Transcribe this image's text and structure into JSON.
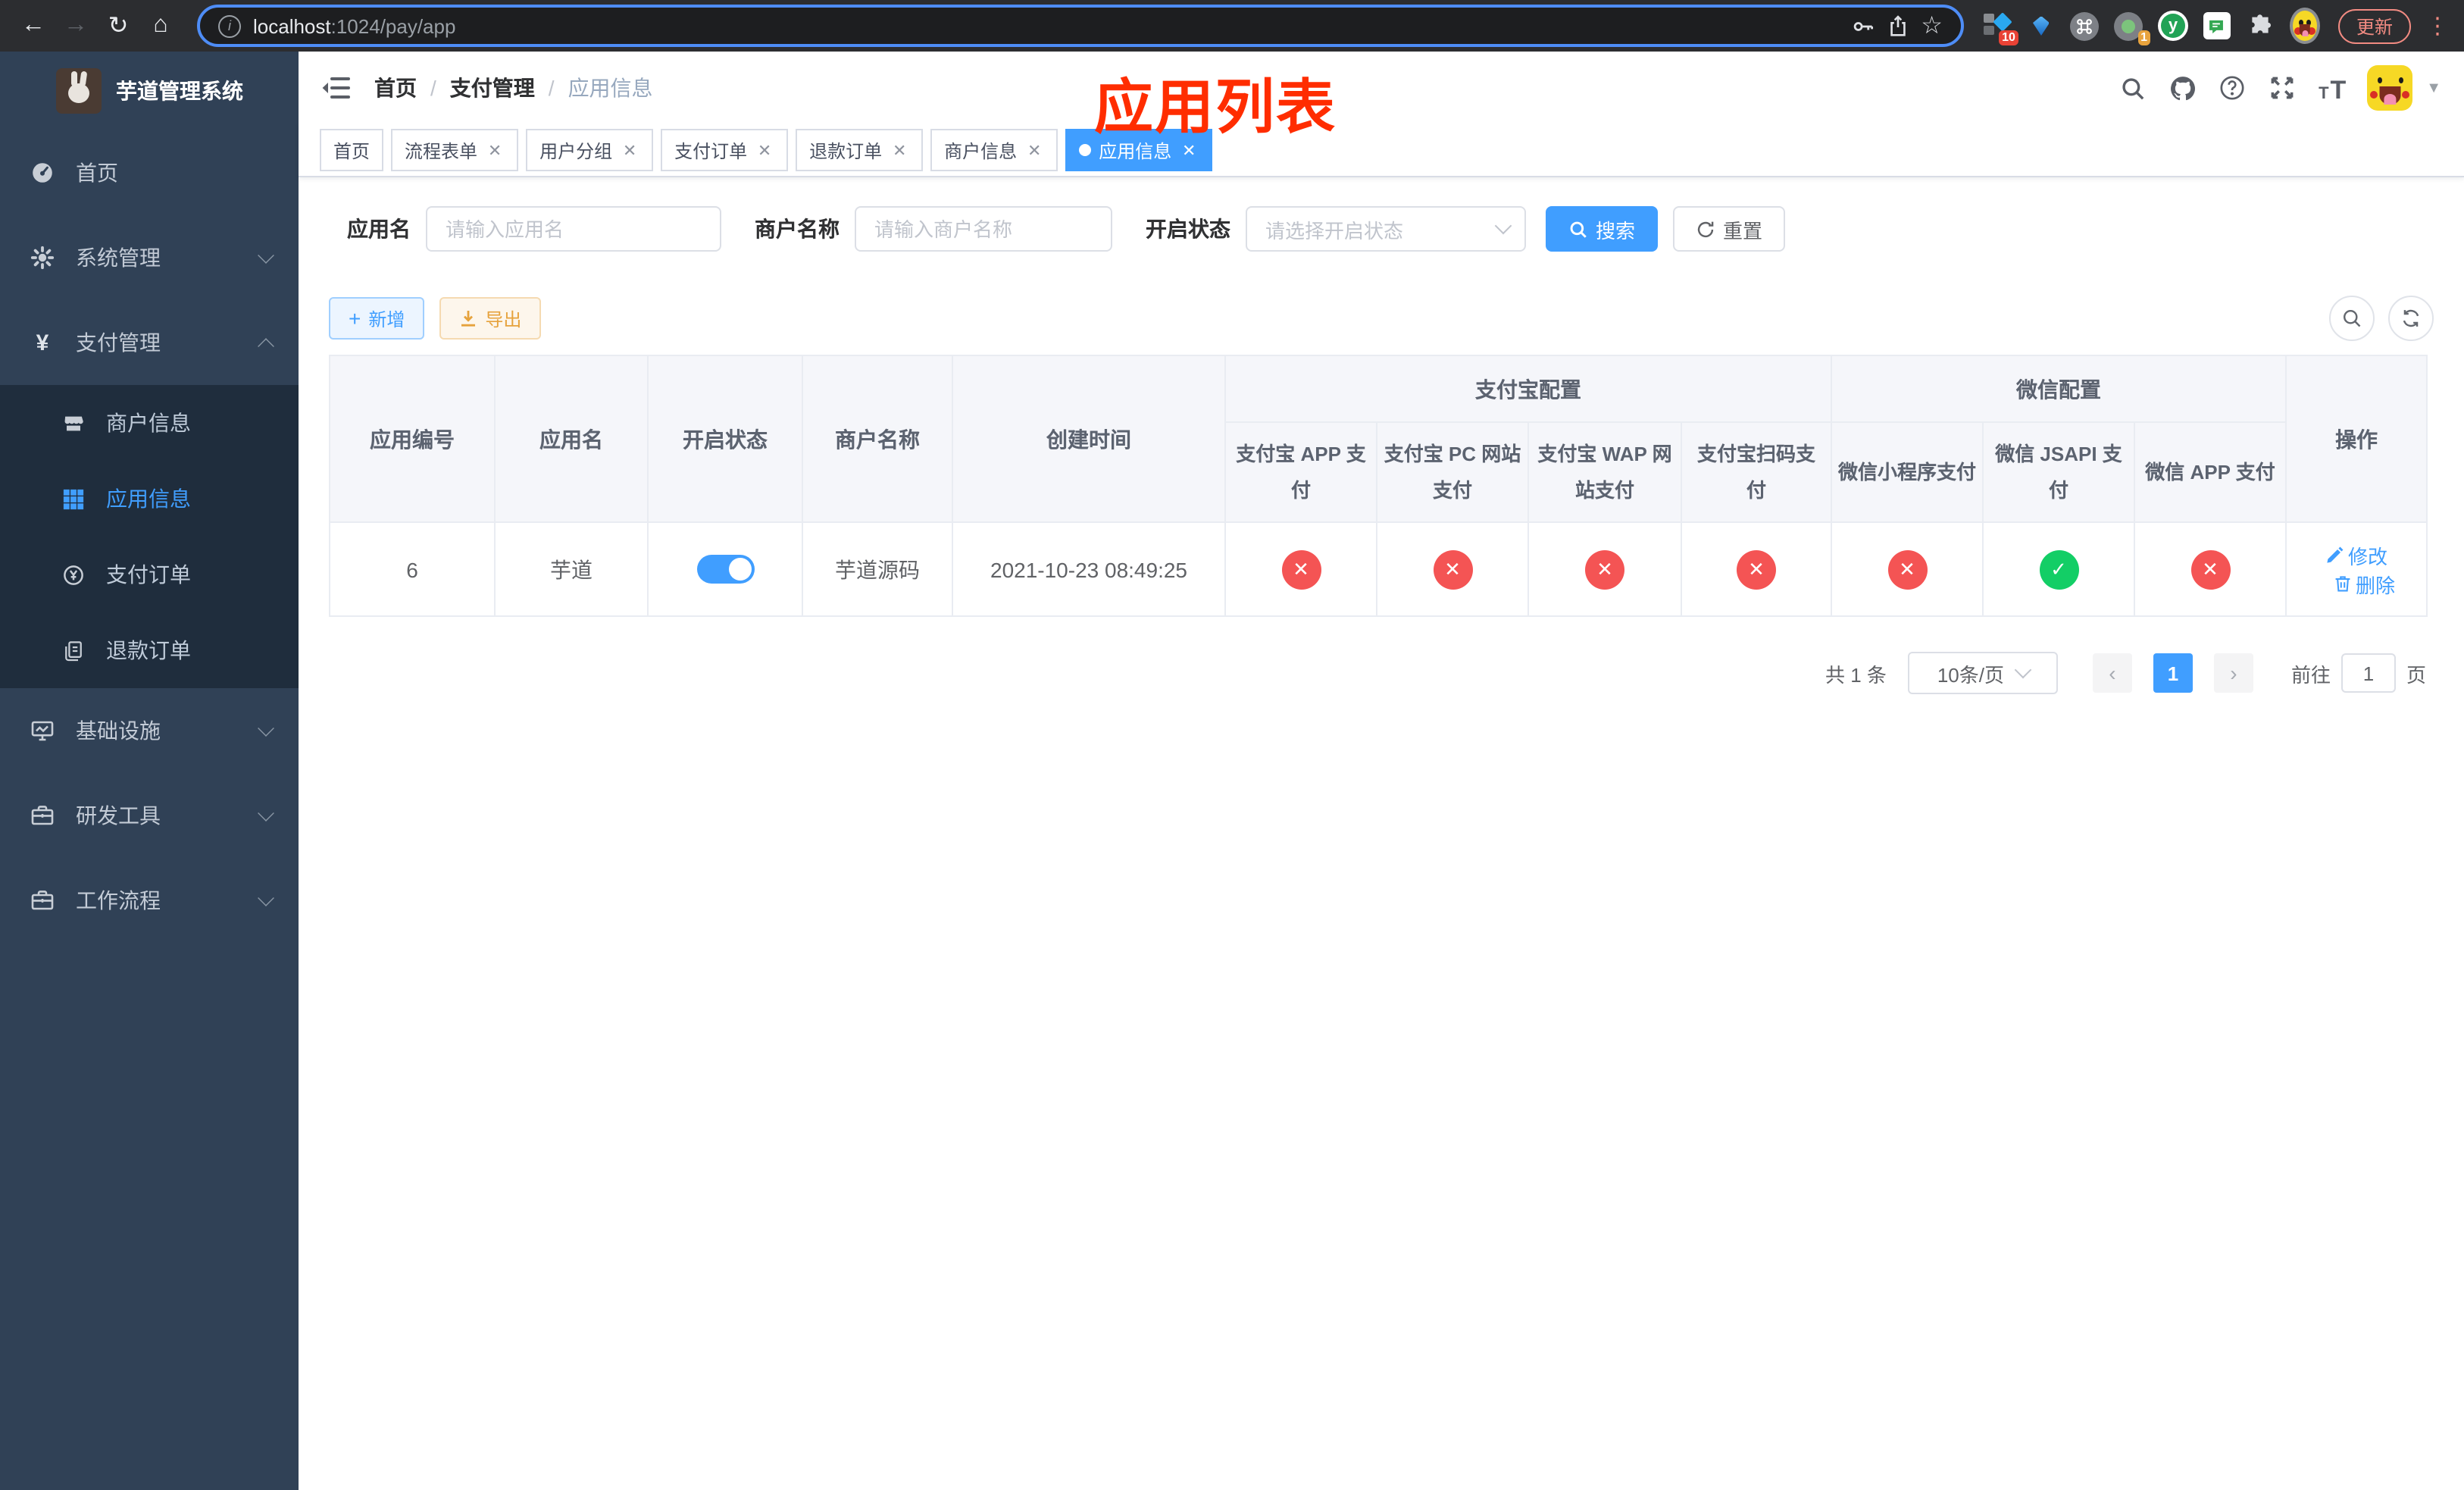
{
  "colors": {
    "primary": "#409eff",
    "success": "#13ce66",
    "danger": "#f45454",
    "warning": "#e6a23c",
    "sidebar_bg": "#304156",
    "submenu_bg": "#1f2d3d",
    "annotation": "#ff2d00",
    "chrome_bg": "#2c2d30",
    "update_button": "#f28b82"
  },
  "browser": {
    "url_host": "localhost",
    "url_path": ":1024/pay/app",
    "update_button": "更新",
    "extension_badge_a": "10",
    "extension_badge_b": "1",
    "extension_y_letter": "y"
  },
  "sidebar": {
    "title": "芋道管理系统",
    "menu": [
      {
        "label": "首页",
        "icon": "dashboard-icon"
      },
      {
        "label": "系统管理",
        "icon": "gear-icon",
        "arrow": "down"
      },
      {
        "label": "支付管理",
        "icon": "yen-icon",
        "arrow": "up",
        "expanded": true
      },
      {
        "label": "商户信息",
        "icon": "shop-icon",
        "sub": true
      },
      {
        "label": "应用信息",
        "icon": "grid-icon",
        "sub": true,
        "active": true
      },
      {
        "label": "支付订单",
        "icon": "coin-icon",
        "sub": true
      },
      {
        "label": "退款订单",
        "icon": "refund-icon",
        "sub": true
      },
      {
        "label": "基础设施",
        "icon": "monitor-icon",
        "arrow": "down"
      },
      {
        "label": "研发工具",
        "icon": "toolbox-icon",
        "arrow": "down"
      },
      {
        "label": "工作流程",
        "icon": "workflow-icon",
        "arrow": "down"
      }
    ]
  },
  "header": {
    "breadcrumb": [
      "首页",
      "支付管理",
      "应用信息"
    ],
    "separator": "/",
    "annotation": "应用列表",
    "right_icons": [
      "search-icon",
      "github-icon",
      "help-icon",
      "fullscreen-icon",
      "font-size-icon",
      "avatar",
      "caret-down-icon"
    ]
  },
  "tabs": [
    {
      "label": "首页",
      "closable": false,
      "active": false
    },
    {
      "label": "流程表单",
      "closable": true,
      "active": false
    },
    {
      "label": "用户分组",
      "closable": true,
      "active": false
    },
    {
      "label": "支付订单",
      "closable": true,
      "active": false
    },
    {
      "label": "退款订单",
      "closable": true,
      "active": false
    },
    {
      "label": "商户信息",
      "closable": true,
      "active": false
    },
    {
      "label": "应用信息",
      "closable": true,
      "active": true
    }
  ],
  "filters": {
    "app_name_label": "应用名",
    "app_name_placeholder": "请输入应用名",
    "merchant_label": "商户名称",
    "merchant_placeholder": "请输入商户名称",
    "status_label": "开启状态",
    "status_placeholder": "请选择开启状态",
    "search_button": "搜索",
    "reset_button": "重置"
  },
  "toolbar": {
    "add_button": "新增",
    "export_button": "导出"
  },
  "table": {
    "columns": {
      "app_id": "应用编号",
      "app_name": "应用名",
      "status": "开启状态",
      "merchant_name": "商户名称",
      "create_time": "创建时间",
      "alipay_group": "支付宝配置",
      "wechat_group": "微信配置",
      "alipay_app": "支付宝 APP 支付",
      "alipay_pc": "支付宝 PC 网站支付",
      "alipay_wap": "支付宝 WAP 网站支付",
      "alipay_qr": "支付宝扫码支付",
      "wx_lite": "微信小程序支付",
      "wx_jsapi": "微信 JSAPI 支付",
      "wx_app": "微信 APP 支付",
      "actions": "操作"
    },
    "row": {
      "app_id": "6",
      "app_name": "芋道",
      "status_on": true,
      "merchant_name": "芋道源码",
      "create_time": "2021-10-23 08:49:25",
      "channels": [
        false,
        false,
        false,
        false,
        false,
        true,
        false
      ],
      "edit_link": "修改",
      "delete_link": "删除"
    }
  },
  "pagination": {
    "total": "共 1 条",
    "page_size": "10条/页",
    "page": "1",
    "goto_label": "前往",
    "goto_value": "1",
    "page_unit": "页"
  }
}
